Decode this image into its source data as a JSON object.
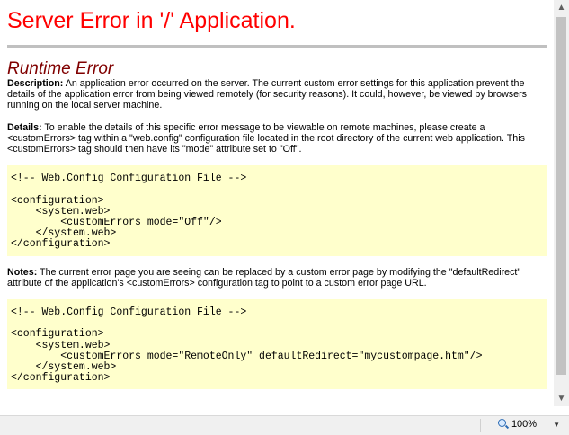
{
  "page": {
    "title": "Server Error in '/' Application.",
    "subtitle": "Runtime Error"
  },
  "description": {
    "label": "Description:",
    "text": " An application error occurred on the server. The current custom error settings for this application prevent the details of the application error from being viewed remotely (for security reasons). It could, however, be viewed by browsers running on the local server machine."
  },
  "details": {
    "label": "Details:",
    "text": " To enable the details of this specific error message to be viewable on remote machines, please create a <customErrors> tag within a \"web.config\" configuration file located in the root directory of the current web application. This <customErrors> tag should then have its \"mode\" attribute set to \"Off\"."
  },
  "code1": "<!-- Web.Config Configuration File -->\n\n<configuration>\n    <system.web>\n        <customErrors mode=\"Off\"/>\n    </system.web>\n</configuration>",
  "notes": {
    "label": "Notes:",
    "text": " The current error page you are seeing can be replaced by a custom error page by modifying the \"defaultRedirect\" attribute of the application's <customErrors> configuration tag to point to a custom error page URL."
  },
  "code2": "<!-- Web.Config Configuration File -->\n\n<configuration>\n    <system.web>\n        <customErrors mode=\"RemoteOnly\" defaultRedirect=\"mycustompage.htm\"/>\n    </system.web>\n</configuration>",
  "statusbar": {
    "zoom_label": "100%",
    "zoom_icon": "magnifier-icon"
  },
  "colors": {
    "title": "#ff0000",
    "subtitle": "#800000",
    "code_bg": "#ffffcc"
  }
}
